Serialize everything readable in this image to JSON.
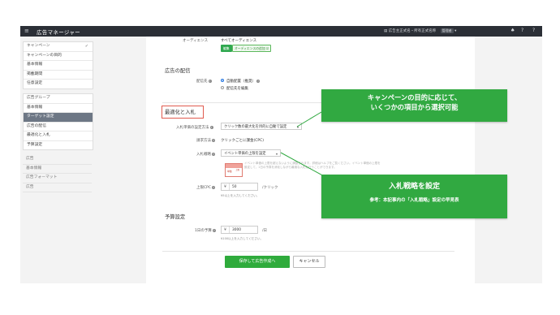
{
  "topbar": {
    "menu_icon": "≡",
    "app_title": "広告マネージャー",
    "account_text": "広告主正式名・所有正式名称",
    "account_badge": "管理者",
    "caret": "▾",
    "bell_icon": "♠",
    "help_icon": "?",
    "user_icon": "?"
  },
  "sidebar": {
    "campaign_group": [
      {
        "label": "キャンペーン",
        "check": "✓"
      },
      {
        "label": "キャンペーンの目的"
      },
      {
        "label": "基本情報"
      },
      {
        "label": "掲載期間"
      },
      {
        "label": "任意設定"
      }
    ],
    "adgroup_group": [
      {
        "label": "広告グループ"
      },
      {
        "label": "基本情報"
      },
      {
        "label": "ターゲット設定"
      },
      {
        "label": "広告の配信"
      },
      {
        "label": "最適化と入札"
      },
      {
        "label": "予算設定"
      }
    ],
    "ad_group": [
      {
        "label": "広告"
      },
      {
        "label": "基本情報"
      },
      {
        "label": "広告フォーマット"
      },
      {
        "label": "広告"
      }
    ]
  },
  "content": {
    "audience_label": "オーディエンス",
    "audience_value": "すべてオーディエンス",
    "chip_edit": "編集",
    "chip_audience": "オーディエンスの追加 ☑",
    "delivery_heading": "広告の配信",
    "placement_label": "配信先",
    "placement_auto": "自動配置（推奨）",
    "placement_manual": "配信先を編集",
    "optimization_heading": "最適化と入札",
    "bid_setting_label": "入札単価の設定方法",
    "bid_setting_value": "クリック数の最大化を目的に自動で設定",
    "billing_label": "請求方法",
    "billing_value": "クリックごとに課金(CPC)",
    "bid_strategy_label": "入札戦略",
    "bid_strategy_value": "イベント単価の上限を設定",
    "diagram_top": "上限",
    "diagram_left": "単価",
    "faint_desc": "イベント単価の上限を超えないように調整されます。詳細はヘルプをご覧ください。イベント単価の上限を設定して、1日の予算を消化しながら最適な入札を行うことができます。",
    "max_cpc_label": "上限CPC",
    "max_cpc_currency": "¥",
    "max_cpc_value": "50",
    "max_cpc_unit": "/クリック",
    "max_cpc_note": "¥5以上を入力してください。",
    "budget_heading": "予算設定",
    "daily_budget_label": "1日の予算",
    "daily_budget_currency": "¥",
    "daily_budget_value": "3000",
    "daily_budget_unit": "/日",
    "daily_budget_note": "¥100以上を入力してください。",
    "save_button": "保存して広告作成へ",
    "cancel_button": "キャンセル",
    "help": "?"
  },
  "callouts": {
    "top_line1": "キャンペーンの目的に応じて、",
    "top_line2": "いくつかの項目から選択可能",
    "bottom_title": "入札戦略を設定",
    "bottom_sub": "参考：本記事内の「入札戦略」設定の早見表"
  },
  "colors": {
    "topbar": "#2b2f36",
    "callout_green": "#31a941",
    "save_green": "#2fab3c",
    "highlight_red": "#e05a4e",
    "sidebar_active": "#6d7785"
  }
}
